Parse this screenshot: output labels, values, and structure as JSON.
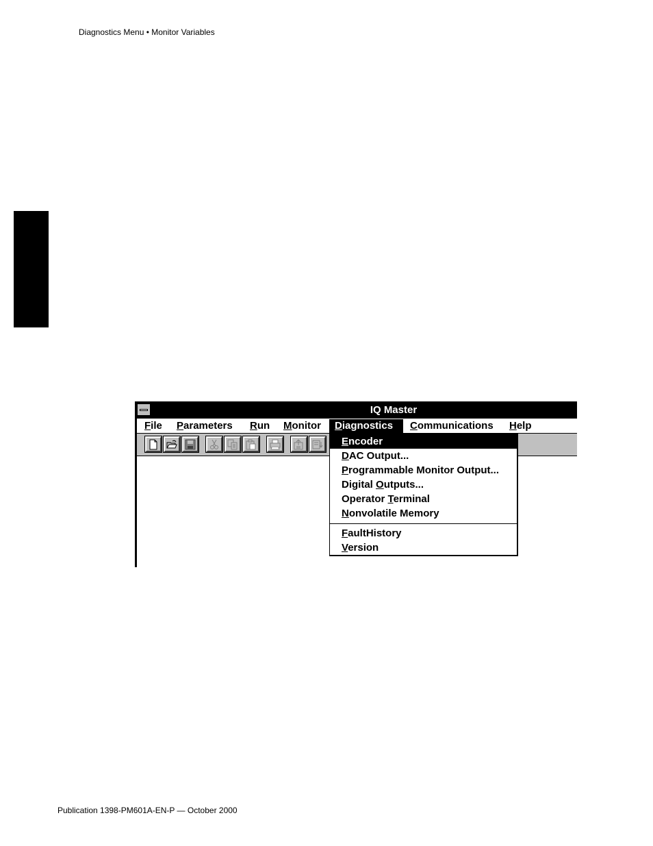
{
  "page": {
    "header": "Diagnostics Menu • Monitor Variables",
    "footer": "Publication 1398-PM601A-EN-P — October 2000"
  },
  "window": {
    "title": "IQ Master",
    "menubar": [
      {
        "mnemonic": "F",
        "rest": "ile"
      },
      {
        "mnemonic": "P",
        "rest": "arameters"
      },
      {
        "mnemonic": "R",
        "rest": "un"
      },
      {
        "mnemonic": "M",
        "rest": "onitor"
      },
      {
        "mnemonic": "D",
        "rest": "iagnostics"
      },
      {
        "mnemonic": "C",
        "rest": "ommunications"
      },
      {
        "mnemonic": "H",
        "rest": "elp"
      }
    ],
    "active_menu": "Diagnostics",
    "toolbar_icons": [
      "new-file-icon",
      "open-folder-icon",
      "save-disk-icon",
      "cut-scissors-icon",
      "copy-icon",
      "paste-icon",
      "print-icon",
      "upload-icon",
      "download-icon"
    ]
  },
  "diagnostics_menu": {
    "items": [
      {
        "pre": "",
        "mnemonic": "E",
        "post": "ncoder"
      },
      {
        "pre": "",
        "mnemonic": "D",
        "post": "AC Output..."
      },
      {
        "pre": "",
        "mnemonic": "P",
        "post": "rogrammable Monitor Output..."
      },
      {
        "pre": "Digital ",
        "mnemonic": "O",
        "post": "utputs..."
      },
      {
        "pre": "Operator ",
        "mnemonic": "T",
        "post": "erminal"
      },
      {
        "pre": "",
        "mnemonic": "N",
        "post": "onvolatile Memory"
      },
      {
        "pre": "",
        "mnemonic": "F",
        "post": "aultHistory"
      },
      {
        "pre": "",
        "mnemonic": "V",
        "post": "ersion"
      }
    ],
    "highlighted": "Encoder"
  },
  "colors": {
    "titlebar": "#000000",
    "toolbar": "#c0c0c0",
    "highlight": "#000000"
  }
}
